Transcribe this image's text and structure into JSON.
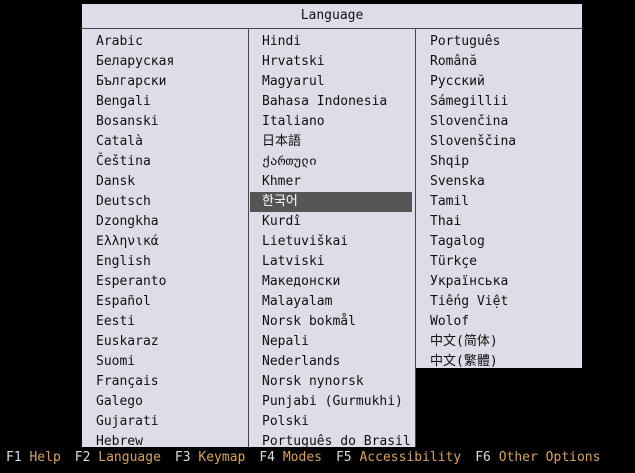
{
  "dialog": {
    "title": "Language",
    "selected": "한국어"
  },
  "columns": [
    [
      "Arabic",
      "Беларуская",
      "Български",
      "Bengali",
      "Bosanski",
      "Català",
      "Čeština",
      "Dansk",
      "Deutsch",
      "Dzongkha",
      "Ελληνικά",
      "English",
      "Esperanto",
      "Español",
      "Eesti",
      "Euskaraz",
      "Suomi",
      "Français",
      "Galego",
      "Gujarati",
      "Hebrew"
    ],
    [
      "Hindi",
      "Hrvatski",
      "Magyarul",
      "Bahasa Indonesia",
      "Italiano",
      "日本語",
      "ქართული",
      "Khmer",
      "한국어",
      "Kurdî",
      "Lietuviškai",
      "Latviski",
      "Македонски",
      "Malayalam",
      "Norsk bokmål",
      "Nepali",
      "Nederlands",
      "Norsk nynorsk",
      "Punjabi (Gurmukhi)",
      "Polski",
      "Português do Brasil"
    ],
    [
      "Português",
      "Română",
      "Русский",
      "Sámegillii",
      "Slovenčina",
      "Slovenščina",
      "Shqip",
      "Svenska",
      "Tamil",
      "Thai",
      "Tagalog",
      "Türkçe",
      "Українська",
      "Tiếng Việt",
      "Wolof",
      "中文(简体)",
      "中文(繁體)"
    ]
  ],
  "statusbar": [
    {
      "key": "F1",
      "label": "Help"
    },
    {
      "key": "F2",
      "label": "Language"
    },
    {
      "key": "F3",
      "label": "Keymap"
    },
    {
      "key": "F4",
      "label": "Modes"
    },
    {
      "key": "F5",
      "label": "Accessibility"
    },
    {
      "key": "F6",
      "label": "Other Options"
    }
  ],
  "colors": {
    "dialog_bg": "#dddde8",
    "selected_bg": "#555555",
    "fkey_label": "#d7a25a"
  }
}
